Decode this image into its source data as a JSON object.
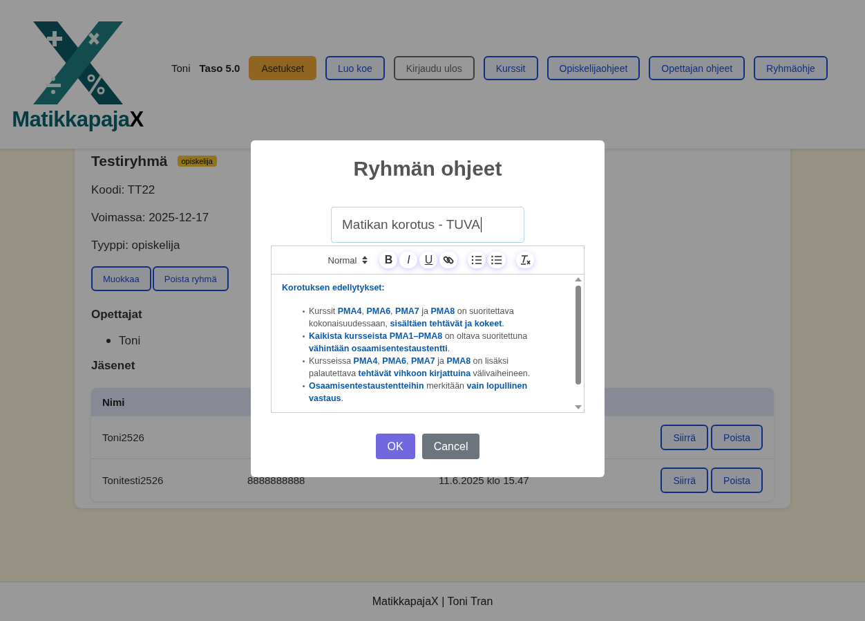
{
  "header": {
    "logo_text": "Matikkapaja**X**",
    "user": "Toni",
    "level": "Taso 5.0",
    "buttons": [
      {
        "label": "Asetukset",
        "kind": "warning"
      },
      {
        "label": "Luo koe",
        "kind": "primary"
      },
      {
        "label": "Kirjaudu ulos",
        "kind": "secondary"
      },
      {
        "label": "Kurssit",
        "kind": "primary"
      },
      {
        "label": "Opiskelijaohjeet",
        "kind": "primary"
      },
      {
        "label": "Opettajan ohjeet",
        "kind": "primary"
      },
      {
        "label": "Ryhmäohje",
        "kind": "primary"
      }
    ]
  },
  "group": {
    "title": "Testiryhmä",
    "badge": "opiskelija",
    "details": [
      "Koodi: TT22",
      "Voimassa: 2025-12-17",
      "Tyyppi: opiskelija"
    ],
    "buttons": [
      "Muokkaa",
      "Poista ryhmä"
    ],
    "teachers_heading": "Opettajat",
    "teachers": [
      "Toni"
    ],
    "members_heading": "Jäsenet",
    "table": {
      "columns": [
        "Nimi"
      ],
      "rows": [
        {
          "cells": [
            "Toni2526"
          ],
          "actions": [
            "Siirrä",
            "Poista"
          ]
        },
        {
          "cells": [
            "Tonitesti2526",
            "8888888888",
            "11.6.2025 klo 15.47"
          ],
          "actions": [
            "Siirrä",
            "Poista"
          ]
        }
      ]
    }
  },
  "modal": {
    "title": "Ryhmän ohjeet",
    "title_value": "Matikan korotus - TUVA",
    "toolbar": {
      "format": "Normal",
      "buttons": [
        {
          "kind": "bold",
          "label": "B"
        },
        {
          "kind": "italic",
          "label": "I"
        },
        {
          "kind": "underline",
          "label": "U"
        },
        {
          "kind": "link"
        },
        {
          "kind": "ordered-list"
        },
        {
          "kind": "bullet-list"
        },
        {
          "kind": "clear"
        }
      ]
    },
    "content": {
      "heading": "Korotuksen edellytykset:",
      "items": [
        "Kurssit **PMA4**, **PMA6**, **PMA7** ja **PMA8** on suoritettava kokonaisuudessaan, **sisältäen tehtävät ja kokeet**.",
        "**Kaikista kursseista PMA1–PMA8** on oltava suoritettuna **vähintään osaamisentestaustentti**.",
        "Kursseissa **PMA4**, **PMA6**, **PMA7** ja **PMA8** on lisäksi palautettava **tehtävät vihkoon kirjattuina** välivaiheineen.",
        "**Osaamisentestaustentteihin** merkitään **vain lopullinen vastaus**."
      ]
    },
    "buttons": [
      {
        "label": "OK",
        "kind": "primary"
      },
      {
        "label": "Cancel",
        "kind": "secondary"
      }
    ]
  },
  "footer": "MatikkapajaX | Toni Tran"
}
